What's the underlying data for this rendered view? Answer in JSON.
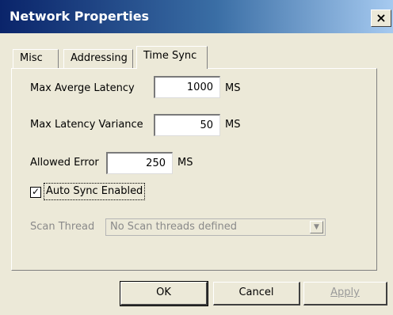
{
  "window": {
    "title": "Network Properties",
    "close_glyph": "×"
  },
  "tabs": [
    {
      "label": "Misc"
    },
    {
      "label": "Addressing"
    },
    {
      "label": "Time Sync"
    }
  ],
  "time_sync": {
    "max_average_latency": {
      "label": "Max Averge Latency",
      "value": "1000",
      "unit": "MS"
    },
    "max_latency_variance": {
      "label": "Max Latency Variance",
      "value": "50",
      "unit": "MS"
    },
    "allowed_error": {
      "label": "Allowed Error",
      "value": "250",
      "unit": "MS"
    },
    "auto_sync": {
      "label": "Auto Sync Enabled",
      "checked": true,
      "check_glyph": "✓"
    },
    "scan_thread": {
      "label": "Scan Thread",
      "selected": "No Scan threads defined",
      "arrow_glyph": "▼"
    }
  },
  "buttons": {
    "ok": "OK",
    "cancel": "Cancel",
    "apply": "Apply"
  }
}
